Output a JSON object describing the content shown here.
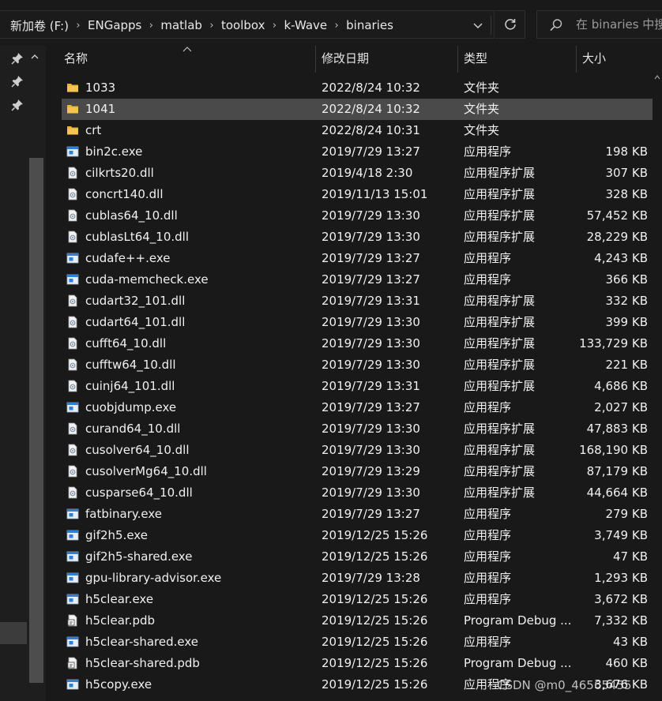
{
  "breadcrumb": {
    "segments": [
      "新加卷 (F:)",
      "ENGapps",
      "matlab",
      "toolbox",
      "k-Wave",
      "binaries"
    ],
    "separator": "›"
  },
  "search": {
    "placeholder": "在 binaries 中搜"
  },
  "columns": {
    "name": "名称",
    "date": "修改日期",
    "type": "类型",
    "size": "大小"
  },
  "colors": {
    "background": "#191919",
    "selected_row": "#4a4a4a",
    "folder": "#e8b43a",
    "exe_icon": "#2f7fd6"
  },
  "files": [
    {
      "name": "1033",
      "date": "2022/8/24 10:32",
      "type": "文件夹",
      "size": "",
      "icon": "folder-icon",
      "selected": false
    },
    {
      "name": "1041",
      "date": "2022/8/24 10:32",
      "type": "文件夹",
      "size": "",
      "icon": "folder-icon",
      "selected": true
    },
    {
      "name": "crt",
      "date": "2022/8/24 10:31",
      "type": "文件夹",
      "size": "",
      "icon": "folder-icon",
      "selected": false
    },
    {
      "name": "bin2c.exe",
      "date": "2019/7/29 13:27",
      "type": "应用程序",
      "size": "198 KB",
      "icon": "exe-icon",
      "selected": false
    },
    {
      "name": "cilkrts20.dll",
      "date": "2019/4/18 2:30",
      "type": "应用程序扩展",
      "size": "307 KB",
      "icon": "dll-icon",
      "selected": false
    },
    {
      "name": "concrt140.dll",
      "date": "2019/11/13 15:01",
      "type": "应用程序扩展",
      "size": "328 KB",
      "icon": "dll-icon",
      "selected": false
    },
    {
      "name": "cublas64_10.dll",
      "date": "2019/7/29 13:30",
      "type": "应用程序扩展",
      "size": "57,452 KB",
      "icon": "dll-icon",
      "selected": false
    },
    {
      "name": "cublasLt64_10.dll",
      "date": "2019/7/29 13:30",
      "type": "应用程序扩展",
      "size": "28,229 KB",
      "icon": "dll-icon",
      "selected": false
    },
    {
      "name": "cudafe++.exe",
      "date": "2019/7/29 13:27",
      "type": "应用程序",
      "size": "4,243 KB",
      "icon": "exe-icon",
      "selected": false
    },
    {
      "name": "cuda-memcheck.exe",
      "date": "2019/7/29 13:27",
      "type": "应用程序",
      "size": "366 KB",
      "icon": "exe-icon",
      "selected": false
    },
    {
      "name": "cudart32_101.dll",
      "date": "2019/7/29 13:31",
      "type": "应用程序扩展",
      "size": "332 KB",
      "icon": "dll-icon",
      "selected": false
    },
    {
      "name": "cudart64_101.dll",
      "date": "2019/7/29 13:30",
      "type": "应用程序扩展",
      "size": "399 KB",
      "icon": "dll-icon",
      "selected": false
    },
    {
      "name": "cufft64_10.dll",
      "date": "2019/7/29 13:30",
      "type": "应用程序扩展",
      "size": "133,729 KB",
      "icon": "dll-icon",
      "selected": false
    },
    {
      "name": "cufftw64_10.dll",
      "date": "2019/7/29 13:30",
      "type": "应用程序扩展",
      "size": "221 KB",
      "icon": "dll-icon",
      "selected": false
    },
    {
      "name": "cuinj64_101.dll",
      "date": "2019/7/29 13:31",
      "type": "应用程序扩展",
      "size": "4,686 KB",
      "icon": "dll-icon",
      "selected": false
    },
    {
      "name": "cuobjdump.exe",
      "date": "2019/7/29 13:27",
      "type": "应用程序",
      "size": "2,027 KB",
      "icon": "exe-icon",
      "selected": false
    },
    {
      "name": "curand64_10.dll",
      "date": "2019/7/29 13:30",
      "type": "应用程序扩展",
      "size": "47,883 KB",
      "icon": "dll-icon",
      "selected": false
    },
    {
      "name": "cusolver64_10.dll",
      "date": "2019/7/29 13:30",
      "type": "应用程序扩展",
      "size": "168,190 KB",
      "icon": "dll-icon",
      "selected": false
    },
    {
      "name": "cusolverMg64_10.dll",
      "date": "2019/7/29 13:29",
      "type": "应用程序扩展",
      "size": "87,179 KB",
      "icon": "dll-icon",
      "selected": false
    },
    {
      "name": "cusparse64_10.dll",
      "date": "2019/7/29 13:30",
      "type": "应用程序扩展",
      "size": "44,664 KB",
      "icon": "dll-icon",
      "selected": false
    },
    {
      "name": "fatbinary.exe",
      "date": "2019/7/29 13:27",
      "type": "应用程序",
      "size": "279 KB",
      "icon": "exe-icon",
      "selected": false
    },
    {
      "name": "gif2h5.exe",
      "date": "2019/12/25 15:26",
      "type": "应用程序",
      "size": "3,749 KB",
      "icon": "exe-icon",
      "selected": false
    },
    {
      "name": "gif2h5-shared.exe",
      "date": "2019/12/25 15:26",
      "type": "应用程序",
      "size": "47 KB",
      "icon": "exe-icon",
      "selected": false
    },
    {
      "name": "gpu-library-advisor.exe",
      "date": "2019/7/29 13:28",
      "type": "应用程序",
      "size": "1,293 KB",
      "icon": "exe-icon",
      "selected": false
    },
    {
      "name": "h5clear.exe",
      "date": "2019/12/25 15:26",
      "type": "应用程序",
      "size": "3,672 KB",
      "icon": "exe-icon",
      "selected": false
    },
    {
      "name": "h5clear.pdb",
      "date": "2019/12/25 15:26",
      "type": "Program Debug ...",
      "size": "7,332 KB",
      "icon": "pdb-icon",
      "selected": false
    },
    {
      "name": "h5clear-shared.exe",
      "date": "2019/12/25 15:26",
      "type": "应用程序",
      "size": "43 KB",
      "icon": "exe-icon",
      "selected": false
    },
    {
      "name": "h5clear-shared.pdb",
      "date": "2019/12/25 15:26",
      "type": "Program Debug ...",
      "size": "460 KB",
      "icon": "pdb-icon",
      "selected": false
    },
    {
      "name": "h5copy.exe",
      "date": "2019/12/25 15:26",
      "type": "应用程序",
      "size": "3,676 KB",
      "icon": "exe-icon",
      "selected": false
    }
  ],
  "watermark": "CSDN @m0_46565455"
}
